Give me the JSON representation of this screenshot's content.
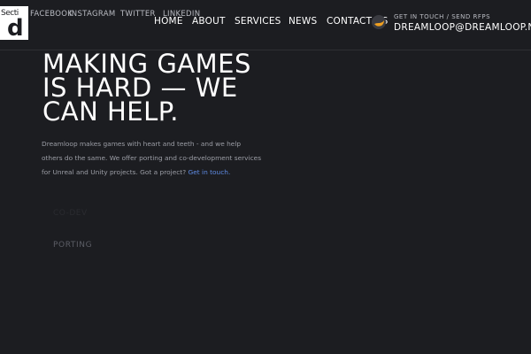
{
  "header": {
    "logo_text": "Secti",
    "logo_letter": "d",
    "social": [
      "FACEBOOK",
      "INSTAGRAM",
      "TWITTER",
      "LINKEDIN"
    ],
    "nav": [
      "HOME",
      "ABOUT",
      "SERVICES",
      "NEWS",
      "CONTACT US"
    ],
    "contact": {
      "label": "GET IN TOUCH / SEND RFPS",
      "email": "DREAMLOOP@DREAMLOOP.NET",
      "icon": "moon-icon",
      "icon_color": "#f0a020"
    }
  },
  "hero": {
    "title_lines": [
      "MAKING GAMES",
      "IS HARD — WE",
      "CAN HELP."
    ],
    "body": "Dreamloop makes games with heart and teeth - and we help others do the same. We offer porting and co-development services for Unreal and Unity projects. Got a project?",
    "cta_link": "Get in touch.",
    "link_color": "#5f8ce6"
  },
  "tabs": {
    "faint": "CO-DEV",
    "porting": "PORTING"
  }
}
